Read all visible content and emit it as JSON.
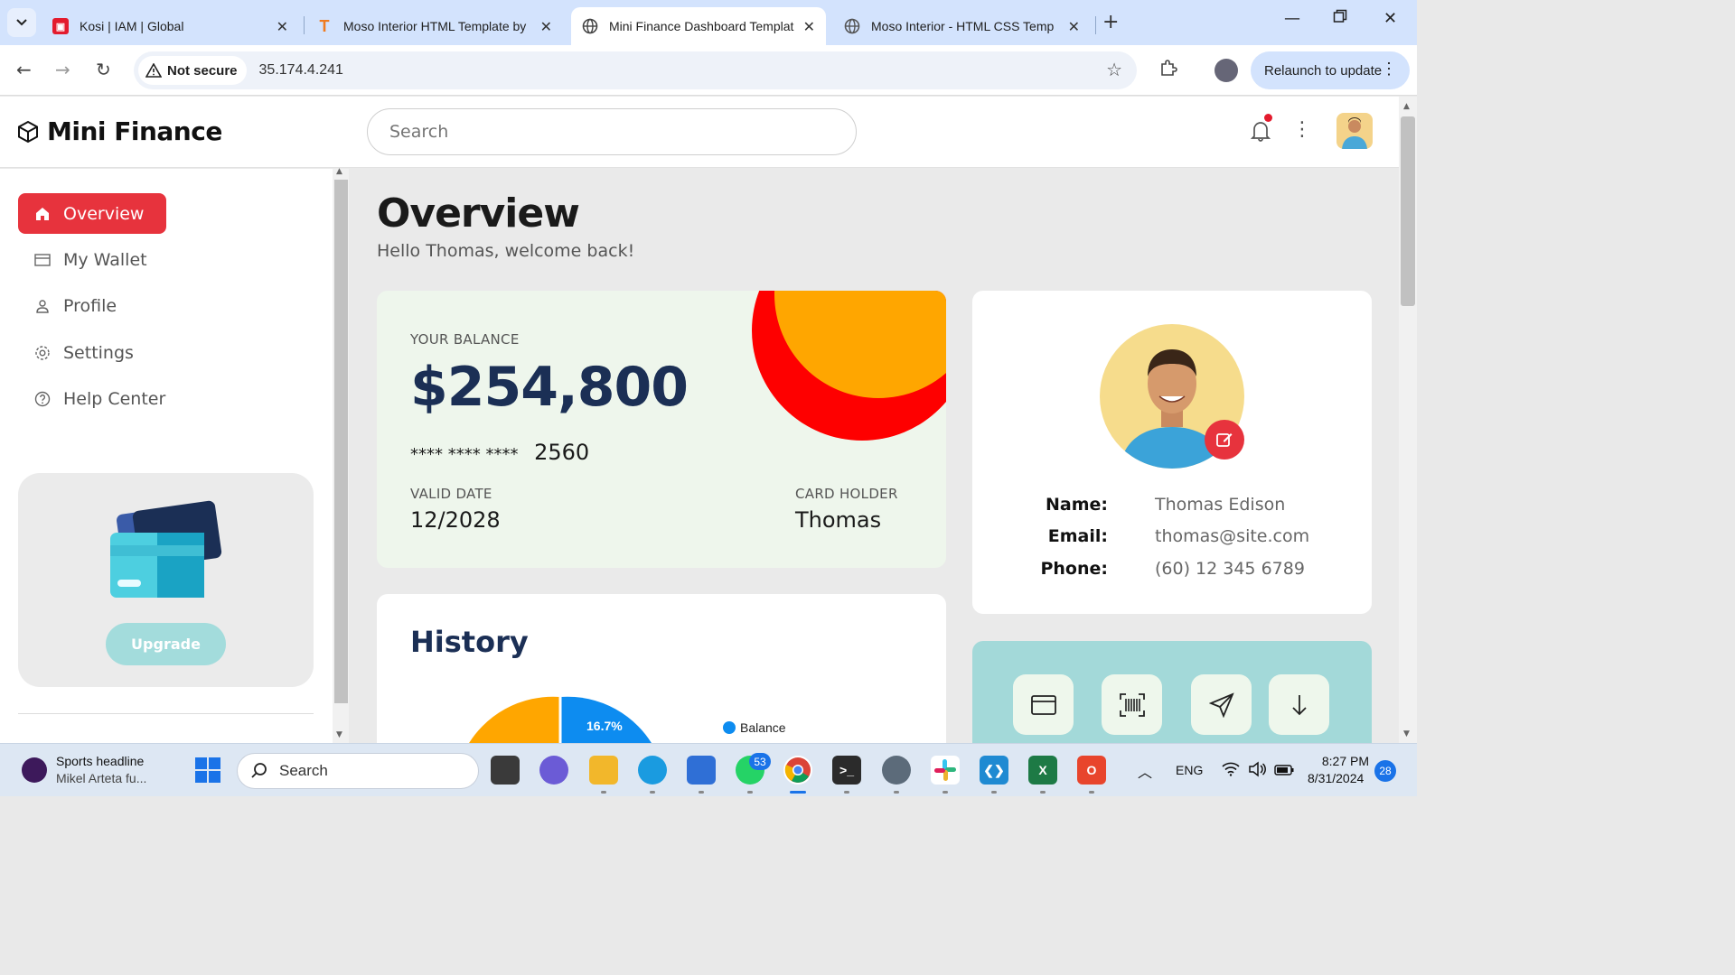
{
  "browser": {
    "tabs": [
      {
        "title": "Kosi | IAM | Global",
        "active": false
      },
      {
        "title": "Moso Interior HTML Template by",
        "active": false
      },
      {
        "title": "Mini Finance Dashboard Template",
        "active": true
      },
      {
        "title": "Moso Interior - HTML CSS Temp",
        "active": false
      }
    ],
    "security_label": "Not secure",
    "url": "35.174.4.241",
    "relaunch_label": "Relaunch to update"
  },
  "app": {
    "brand": "Mini Finance",
    "search_placeholder": "Search",
    "nav": [
      {
        "label": "Overview",
        "active": true
      },
      {
        "label": "My Wallet",
        "active": false
      },
      {
        "label": "Profile",
        "active": false
      },
      {
        "label": "Settings",
        "active": false
      },
      {
        "label": "Help Center",
        "active": false
      }
    ],
    "upgrade_label": "Upgrade"
  },
  "main": {
    "title": "Overview",
    "subtitle": "Hello Thomas, welcome back!",
    "balance": {
      "label": "YOUR BALANCE",
      "amount": "$254,800",
      "card_mask": "****  ****  ****",
      "card_last4": "2560",
      "valid_label": "VALID DATE",
      "valid_value": "12/2028",
      "holder_label": "CARD HOLDER",
      "holder_value": "Thomas"
    },
    "profile": {
      "name_label": "Name:",
      "name": "Thomas Edison",
      "email_label": "Email:",
      "email": "thomas@site.com",
      "phone_label": "Phone:",
      "phone": "(60) 12 345 6789"
    },
    "history": {
      "title": "History",
      "legend": [
        {
          "label": "Balance",
          "color": "#0d8cf0"
        }
      ],
      "slice_label": "16.7%"
    }
  },
  "colors": {
    "accent": "#e7333d",
    "navy": "#1b2f55",
    "orange": "#ffa600",
    "red": "#fe0000",
    "teal": "#a3d9d9"
  },
  "taskbar": {
    "news_title": "Sports headline",
    "news_sub": "Mikel Arteta fu...",
    "search_placeholder": "Search",
    "whatsapp_badge": "53",
    "language": "ENG",
    "time": "8:27 PM",
    "date": "8/31/2024",
    "notif_count": "28"
  }
}
